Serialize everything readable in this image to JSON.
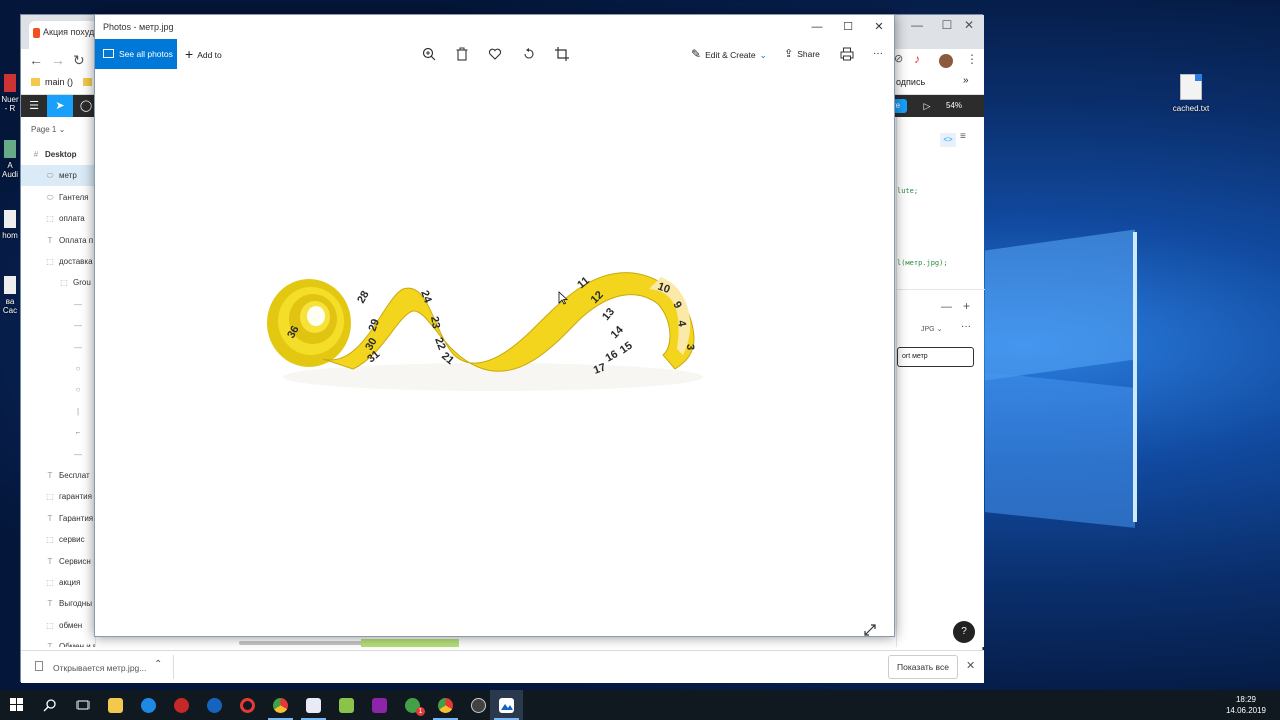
{
  "desktop": {
    "icons": [
      {
        "name": "cached-file-icon",
        "label": "cached.txt"
      },
      {
        "label": "Nuer\n- R"
      },
      {
        "label": "A\nAudi"
      },
      {
        "label": "hom"
      },
      {
        "label": "ва\nCac"
      }
    ]
  },
  "chrome": {
    "tab_title": "Акция похуд",
    "bookmarks": [
      "main ()"
    ],
    "bookmark_right": "одпись",
    "zoom": "54%",
    "share_label": "re",
    "code_lines": [
      "lute;",
      "l(метр.jpg);"
    ],
    "export_format": "JPG",
    "export_button": "ort метр",
    "downloads": {
      "item": "Открывается метр.jpg...",
      "show_all": "Показать все"
    }
  },
  "figma": {
    "page_label": "Page 1",
    "layers": [
      {
        "icon": "#",
        "label": "Desktop",
        "indent": 0,
        "bold": true
      },
      {
        "icon": "⬭",
        "label": "метр",
        "indent": 1,
        "selected": true
      },
      {
        "icon": "⬭",
        "label": "Гантеля",
        "indent": 1
      },
      {
        "icon": "⬚",
        "label": "оплата",
        "indent": 1
      },
      {
        "icon": "T",
        "label": "Оплата п",
        "indent": 1
      },
      {
        "icon": "⬚",
        "label": "доставка",
        "indent": 1
      },
      {
        "icon": "⬚",
        "label": "Grou",
        "indent": 2
      },
      {
        "icon": "—",
        "label": "",
        "indent": 3
      },
      {
        "icon": "—",
        "label": "",
        "indent": 3
      },
      {
        "icon": "—",
        "label": "",
        "indent": 3
      },
      {
        "icon": "○",
        "label": "",
        "indent": 3
      },
      {
        "icon": "○",
        "label": "",
        "indent": 3
      },
      {
        "icon": "|",
        "label": "",
        "indent": 3
      },
      {
        "icon": "⌐",
        "label": "",
        "indent": 3
      },
      {
        "icon": "—",
        "label": "",
        "indent": 3
      },
      {
        "icon": "T",
        "label": "Бесплат",
        "indent": 1
      },
      {
        "icon": "⬚",
        "label": "гарантия",
        "indent": 1
      },
      {
        "icon": "T",
        "label": "Гарантия",
        "indent": 1
      },
      {
        "icon": "⬚",
        "label": "сервис",
        "indent": 1
      },
      {
        "icon": "T",
        "label": "Сервисн",
        "indent": 1
      },
      {
        "icon": "⬚",
        "label": "акция",
        "indent": 1
      },
      {
        "icon": "T",
        "label": "Выгодны",
        "indent": 1
      },
      {
        "icon": "⬚",
        "label": "обмен",
        "indent": 1
      },
      {
        "icon": "T",
        "label": "Обмен и возврат",
        "indent": 1
      }
    ]
  },
  "photos": {
    "title": "Photos - метр.jpg",
    "see_all": "See all photos",
    "add_to": "Add to",
    "edit_create": "Edit & Create",
    "share": "Share",
    "more": "···",
    "tape_numbers": [
      "28",
      "29",
      "30",
      "31",
      "24",
      "23",
      "22",
      "21",
      "11",
      "12",
      "13",
      "14",
      "15",
      "16",
      "17",
      "10",
      "9",
      "4",
      "3",
      "36"
    ]
  },
  "taskbar": {
    "time": "18:29",
    "date": "14.06.2019",
    "whatsapp_badge": "1"
  }
}
